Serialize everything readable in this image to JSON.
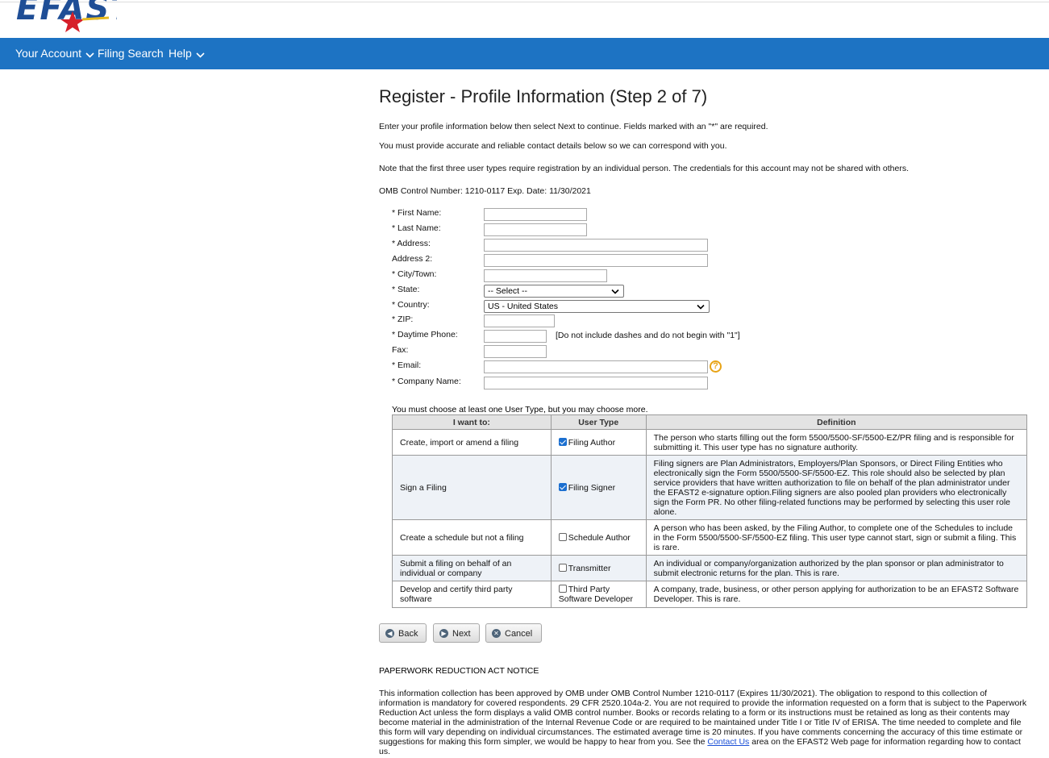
{
  "header": {
    "logo_text": "EFAST"
  },
  "nav": {
    "account": "Your Account",
    "filing_search": "Filing Search",
    "help": "Help"
  },
  "page": {
    "title": "Register - Profile Information (Step 2 of 7)",
    "intro1": "Enter your profile information below then select Next to continue. Fields marked with an \"*\" are required.",
    "intro2": "You must provide accurate and reliable contact details below so we can correspond with you.",
    "intro3": "Note that the first three user types require registration by an individual person. The credentials for this account may not be shared with others.",
    "omb": "OMB Control Number: 1210-0117 Exp. Date: 11/30/2021"
  },
  "form": {
    "first_name_label": "* First Name:",
    "first_name_value": "",
    "last_name_label": "* Last Name:",
    "last_name_value": "",
    "address_label": "* Address:",
    "address_value": "",
    "address2_label": "Address 2:",
    "address2_value": "",
    "city_label": "* City/Town:",
    "city_value": "",
    "state_label": "* State:",
    "state_value": "-- Select --",
    "country_label": "* Country:",
    "country_value": "US - United States",
    "zip_label": "* ZIP:",
    "zip_value": "",
    "phone_label": "* Daytime Phone:",
    "phone_value": "",
    "phone_hint": "[Do not include dashes and do not begin with \"1\"]",
    "fax_label": "Fax:",
    "fax_value": "",
    "email_label": "* Email:",
    "email_value": "",
    "company_label": "* Company Name:",
    "company_value": ""
  },
  "user_types": {
    "intro": "You must choose at least one User Type, but you may choose more.",
    "headers": [
      "I want to:",
      "User Type",
      "Definition"
    ],
    "rows": [
      {
        "want": "Create, import or amend a filing",
        "type": "Filing Author",
        "checked": true,
        "definition": "The person who starts filling out the form 5500/5500-SF/5500-EZ/PR filing and is responsible for submitting it. This user type has no signature authority."
      },
      {
        "want": "Sign a Filing",
        "type": "Filing Signer",
        "checked": true,
        "definition": "Filing signers are Plan Administrators, Employers/Plan Sponsors, or Direct Filing Entities who electronically sign the Form 5500/5500-SF/5500-EZ. This role should also be selected by plan service providers that have written authorization to file on behalf of the plan administrator under the EFAST2 e-signature option.Filing signers are also pooled plan providers who electronically sign the Form PR. No other filing-related functions may be performed by selecting this user role alone."
      },
      {
        "want": "Create a schedule but not a filing",
        "type": "Schedule Author",
        "checked": false,
        "definition": "A person who has been asked, by the Filing Author, to complete one of the Schedules to include in the Form 5500/5500-SF/5500-EZ filing. This user type cannot start, sign or submit a filing. This is rare."
      },
      {
        "want": "Submit a filing on behalf of an individual or company",
        "type": "Transmitter",
        "checked": false,
        "definition": "An individual or company/organization authorized by the plan sponsor or plan administrator to submit electronic returns for the plan. This is rare."
      },
      {
        "want": "Develop and certify third party software",
        "type": "Third Party Software Developer",
        "checked": false,
        "definition": "A company, trade, business, or other person applying for authorization to be an EFAST2 Software Developer. This is rare."
      }
    ]
  },
  "buttons": {
    "back": "Back",
    "next": "Next",
    "cancel": "Cancel"
  },
  "paperwork": {
    "title": "PAPERWORK REDUCTION ACT NOTICE",
    "body_before_link": "This information collection has been approved by OMB under OMB Control Number 1210-0117 (Expires 11/30/2021). The obligation to respond to this collection of information is mandatory for covered respondents. 29 CFR 2520.104a-2. You are not required to provide the information requested on a form that is subject to the Paperwork Reduction Act unless the form displays a valid OMB control number. Books or records relating to a form or its instructions must be retained as long as their contents may become material in the administration of the Internal Revenue Code or are required to be maintained under Title I or Title IV of ERISA. The time needed to complete and file this form will vary depending on individual circumstances. The estimated average time is 20 minutes. If you have comments concerning the accuracy of this time estimate or suggestions for making this form simpler, we would be happy to hear from you. See the ",
    "link": "Contact Us",
    "body_after_link": " area on the EFAST2 Web page for information regarding how to contact us."
  }
}
